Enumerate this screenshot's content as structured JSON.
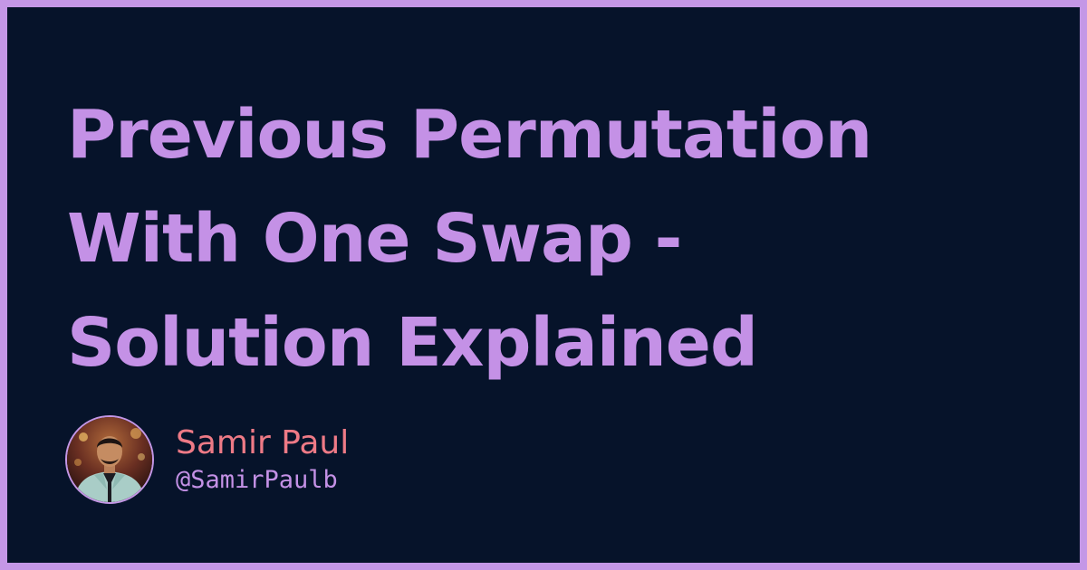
{
  "title": {
    "lines": [
      "Previous Permutation",
      "With One Swap -",
      "Solution Explained"
    ]
  },
  "author": {
    "name": "Samir Paul",
    "handle": "@SamirPaulb"
  },
  "colors": {
    "frame": "#c497e6",
    "background": "#06132a",
    "title": "#c491e6",
    "author_name": "#ee7a86",
    "author_handle": "#c491e6"
  },
  "icons": {
    "avatar": "author-avatar-photo"
  }
}
